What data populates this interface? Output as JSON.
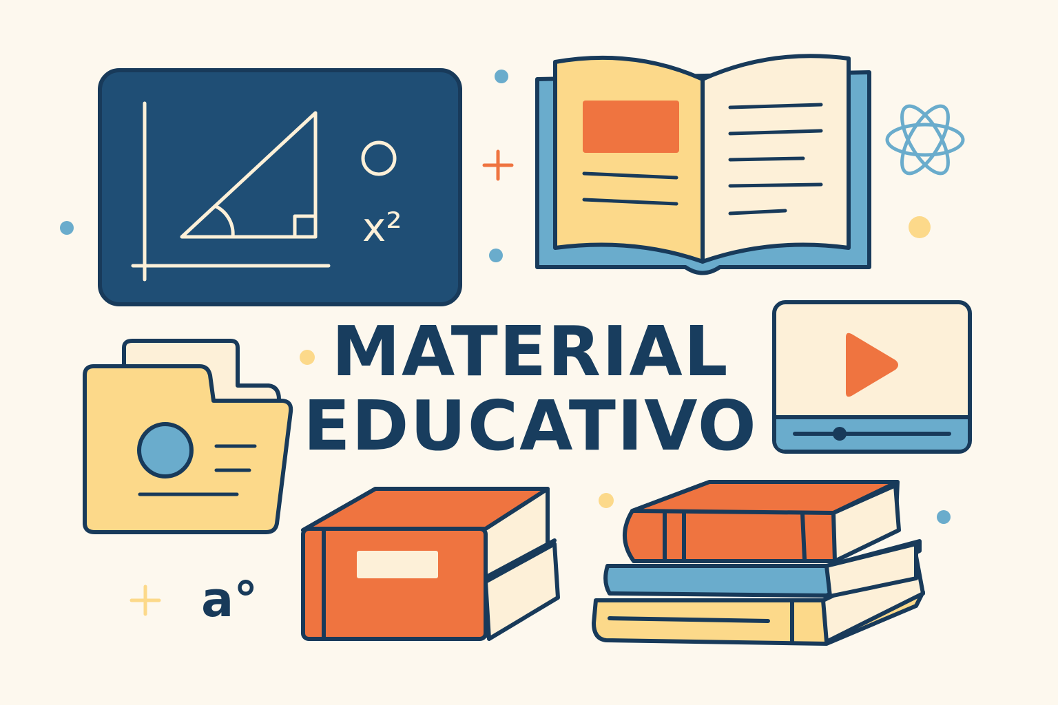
{
  "title": {
    "line1": "MATERIAL",
    "line2": "EDUCATIVO"
  },
  "chalkboard": {
    "formula": "x²"
  },
  "decor": {
    "degree_symbol": "a°"
  },
  "colors": {
    "background": "#fdf8ee",
    "navy": "#1f4e75",
    "outline": "#183a5a",
    "orange": "#ef7440",
    "yellow": "#fcd98a",
    "blue": "#6aaccc",
    "cream": "#fdf0d8"
  }
}
